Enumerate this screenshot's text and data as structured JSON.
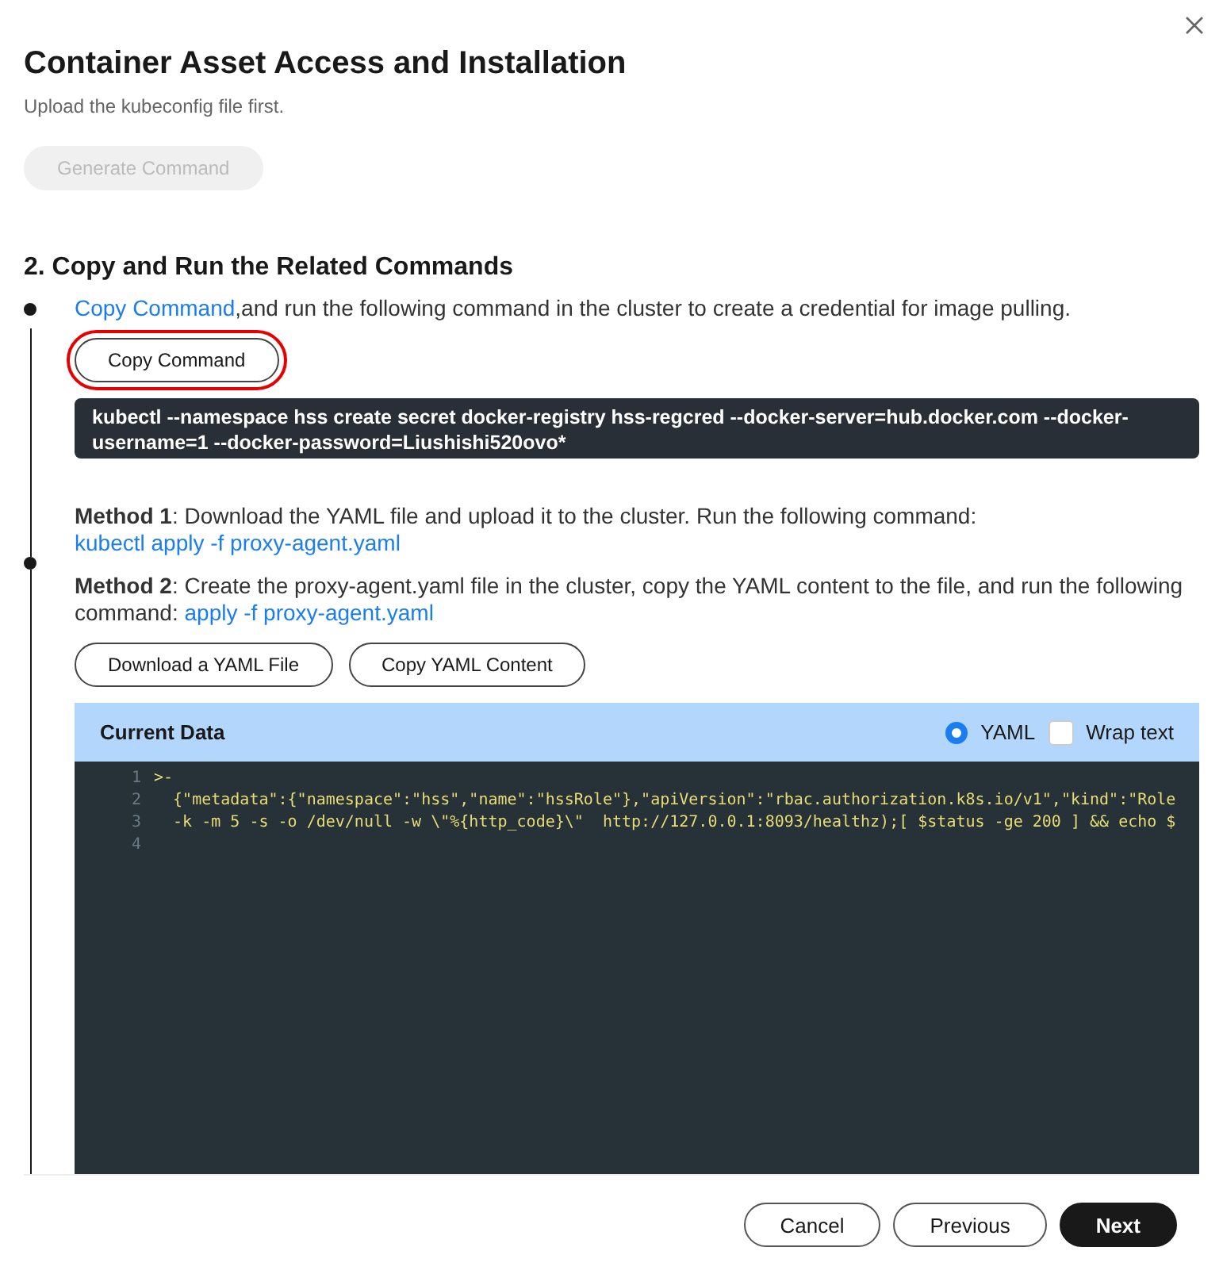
{
  "dialog": {
    "title": "Container Asset Access and Installation",
    "subtitle": "Upload the kubeconfig file first.",
    "generate_button": {
      "label": "Generate Command",
      "disabled": true
    }
  },
  "section": {
    "title": "2. Copy and Run the Related Commands"
  },
  "step_1": {
    "link": "Copy Command",
    "text": ",and run the following command in the cluster to create a credential for image pulling.",
    "copy_button": {
      "label": "Copy Command",
      "highlighted": true
    },
    "command": "kubectl --namespace hss create secret docker-registry hss-regcred --docker-server=hub.docker.com --docker-username=1 --docker-password=Liushishi520ovo*"
  },
  "step_2": {
    "methods": [
      {
        "label": "Method 1",
        "text": ": Download the YAML file and upload it to the cluster. Run the following command: ",
        "command": "kubectl apply -f proxy-agent.yaml"
      },
      {
        "label": "Method 2",
        "text": ": Create the proxy-agent.yaml file in the cluster, copy the YAML content to the file, and run the following command: ",
        "command": "apply -f proxy-agent.yaml"
      }
    ],
    "buttons": [
      "Download a YAML File",
      "Copy YAML Content"
    ],
    "editor": {
      "title": "Current Data",
      "yaml_radio": {
        "label": "YAML",
        "selected": true
      },
      "wrap_checkbox": {
        "label": "Wrap text",
        "checked": false
      },
      "lines": [
        {
          "number": "1",
          "text": ">-"
        },
        {
          "number": "2",
          "text": "  {\"metadata\":{\"namespace\":\"hss\",\"name\":\"hssRole\"},\"apiVersion\":\"rbac.authorization.k8s.io/v1\",\"kind\":\"Role"
        },
        {
          "number": "3",
          "text": "  -k -m 5 -s -o /dev/null -w \\\"%{http_code}\\\"  http://127.0.0.1:8093/healthz);[ $status -ge 200 ] && echo $"
        },
        {
          "number": "4"
        }
      ]
    }
  },
  "footer": {
    "buttons": [
      {
        "label": "Cancel",
        "kind": "secondary"
      },
      {
        "label": "Previous",
        "kind": "secondary"
      },
      {
        "label": "Next",
        "kind": "primary"
      }
    ]
  }
}
